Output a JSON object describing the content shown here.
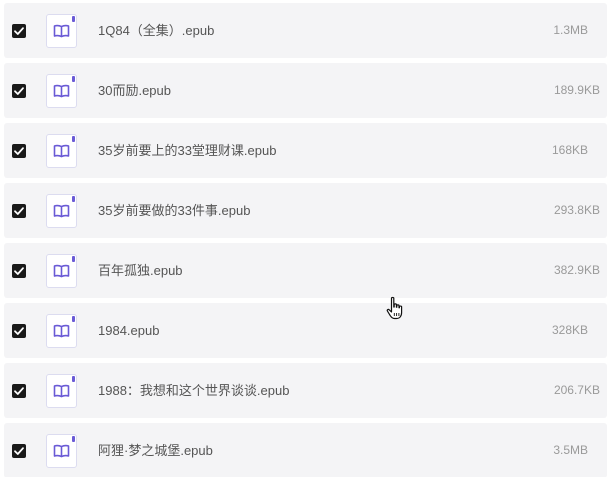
{
  "files": [
    {
      "name": "1Q84（全集）.epub",
      "size": "1.3MB",
      "checked": true
    },
    {
      "name": "30而励.epub",
      "size": "189.9KB",
      "checked": true
    },
    {
      "name": "35岁前要上的33堂理财课.epub",
      "size": "168KB",
      "checked": true
    },
    {
      "name": "35岁前要做的33件事.epub",
      "size": "293.8KB",
      "checked": true
    },
    {
      "name": "百年孤独.epub",
      "size": "382.9KB",
      "checked": true
    },
    {
      "name": "1984.epub",
      "size": "328KB",
      "checked": true
    },
    {
      "name": "1988：我想和这个世界谈谈.epub",
      "size": "206.7KB",
      "checked": true
    },
    {
      "name": "阿狸·梦之城堡.epub",
      "size": "3.5MB",
      "checked": true
    }
  ],
  "icons": {
    "checkbox": "checkmark-icon",
    "file": "book-icon",
    "cursor": "hand-pointer-icon"
  },
  "colors": {
    "row_bg": "#f4f4f6",
    "checkbox": "#1a1a1a",
    "icon_accent": "#6a5ad6",
    "name_text": "#555555",
    "size_text": "#9a9a9a"
  }
}
